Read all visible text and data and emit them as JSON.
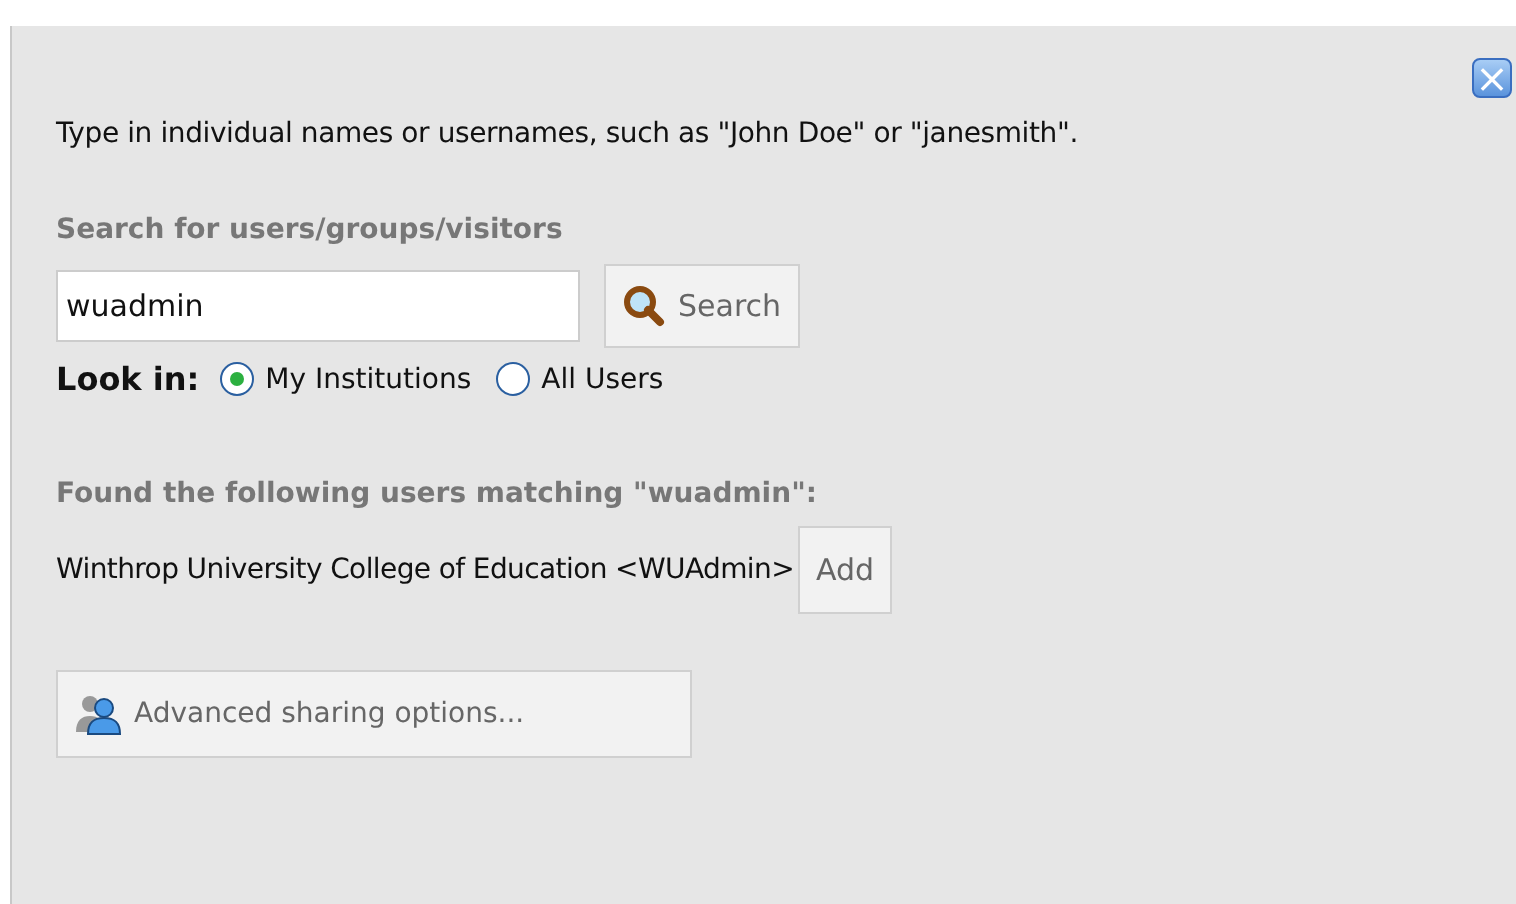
{
  "dialog": {
    "close": "×",
    "intro": "Type in individual names or usernames, such as \"John Doe\" or \"janesmith\".",
    "search_heading": "Search for users/groups/visitors",
    "search_field": {
      "value": "wuadmin"
    },
    "search_button": "Search",
    "look_in": {
      "label": "Look in:",
      "options": [
        {
          "label": "My Institutions",
          "selected": true
        },
        {
          "label": "All Users",
          "selected": false
        }
      ]
    },
    "results_heading": "Found the following users matching \"wuadmin\":",
    "results": [
      {
        "name": "Winthrop University College of Education <WUAdmin>",
        "button": "Add"
      }
    ],
    "advanced_button": "Advanced sharing options..."
  }
}
